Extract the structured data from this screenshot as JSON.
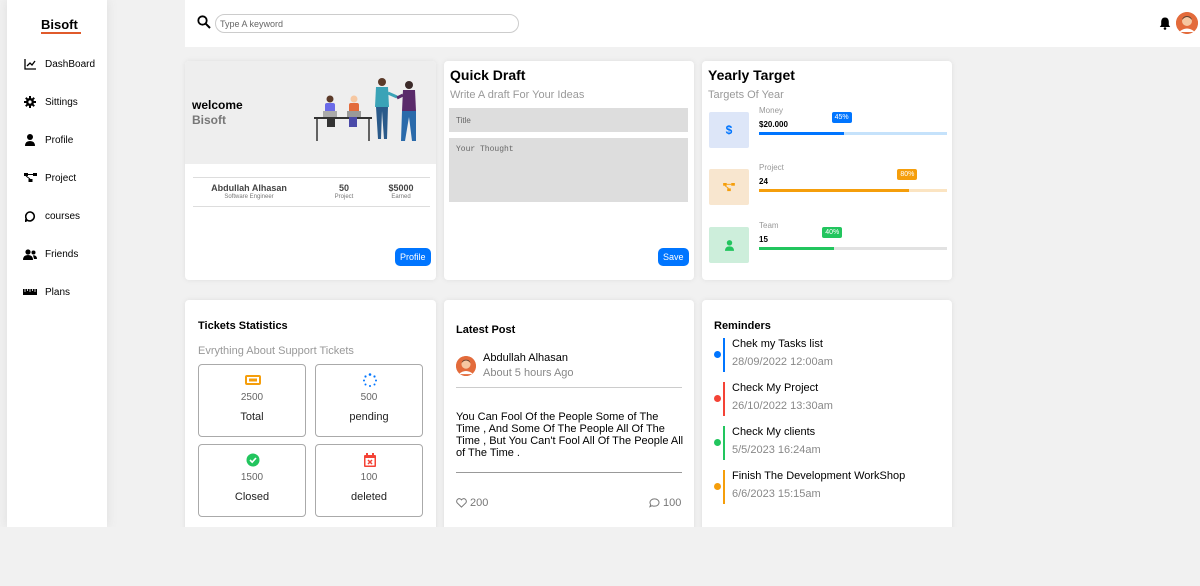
{
  "sidebar": {
    "brand": "Bisoft",
    "items": [
      {
        "label": "DashBoard",
        "icon": "chart-line-icon"
      },
      {
        "label": "Sittings",
        "icon": "gear-icon"
      },
      {
        "label": "Profile",
        "icon": "user-icon"
      },
      {
        "label": "Project",
        "icon": "project-diagram-icon"
      },
      {
        "label": "courses",
        "icon": "comment-icon"
      },
      {
        "label": "Friends",
        "icon": "users-icon"
      },
      {
        "label": "Plans",
        "icon": "ruler-icon"
      }
    ]
  },
  "header": {
    "search_placeholder": "Type A keyword"
  },
  "welcome": {
    "greeting": "welcome",
    "name": "Bisoft",
    "person_name": "Abdullah Alhasan",
    "person_role": "Software Engineer",
    "projects_value": "50",
    "projects_label": "Project",
    "earned_value": "$5000",
    "earned_label": "Earned",
    "button": "Profile"
  },
  "quick_draft": {
    "title": "Quick Draft",
    "subtitle": "Write A draft For Your Ideas",
    "title_placeholder": "Title",
    "thought_placeholder": "Your Thought",
    "button": "Save"
  },
  "yearly_target": {
    "title": "Yearly Target",
    "subtitle": "Targets Of Year",
    "targets": [
      {
        "label": "Money",
        "value": "$20.000",
        "percent": 45,
        "badge": "45%",
        "color": "#0075ff",
        "track": "#c5e2fb",
        "box_bg": "#dde6f8",
        "icon": "dollar-icon"
      },
      {
        "label": "Project",
        "value": "24",
        "percent": 80,
        "badge": "80%",
        "color": "#f59e0b",
        "track": "#fbe4c2",
        "box_bg": "#f8e6cf",
        "icon": "project-diagram-icon"
      },
      {
        "label": "Team",
        "value": "15",
        "percent": 40,
        "badge": "40%",
        "color": "#22c55e",
        "track": "#e2e2e2",
        "box_bg": "#cdeedb",
        "icon": "user-icon"
      }
    ]
  },
  "tickets": {
    "title": "Tickets Statistics",
    "subtitle": "Evrything About Support Tickets",
    "items": [
      {
        "value": "2500",
        "label": "Total",
        "icon": "ticket-icon",
        "color": "#f59e0b"
      },
      {
        "value": "500",
        "label": "pending",
        "icon": "spinner-icon",
        "color": "#0075ff"
      },
      {
        "value": "1500",
        "label": "Closed",
        "icon": "check-circle-icon",
        "color": "#22c55e"
      },
      {
        "value": "100",
        "label": "deleted",
        "icon": "calendar-x-icon",
        "color": "#f44336"
      }
    ]
  },
  "latest_post": {
    "title": "Latest Post",
    "author": "Abdullah Alhasan",
    "time": "About 5 hours Ago",
    "body": "You Can Fool Of the People Some of The Time , And Some Of The People All Of The Time , But You Can't Fool All Of The People All of The Time .",
    "likes": "200",
    "comments": "100"
  },
  "reminders": {
    "title": "Reminders",
    "items": [
      {
        "title": "Chek my Tasks list",
        "date": "28/09/2022 12:00am",
        "color": "#0075ff"
      },
      {
        "title": "Check My Project",
        "date": "26/10/2022 13:30am",
        "color": "#f44336"
      },
      {
        "title": "Check My clients",
        "date": "5/5/2023 16:24am",
        "color": "#22c55e"
      },
      {
        "title": "Finish The Development WorkShop",
        "date": "6/6/2023 15:15am",
        "color": "#f59e0b"
      }
    ]
  }
}
